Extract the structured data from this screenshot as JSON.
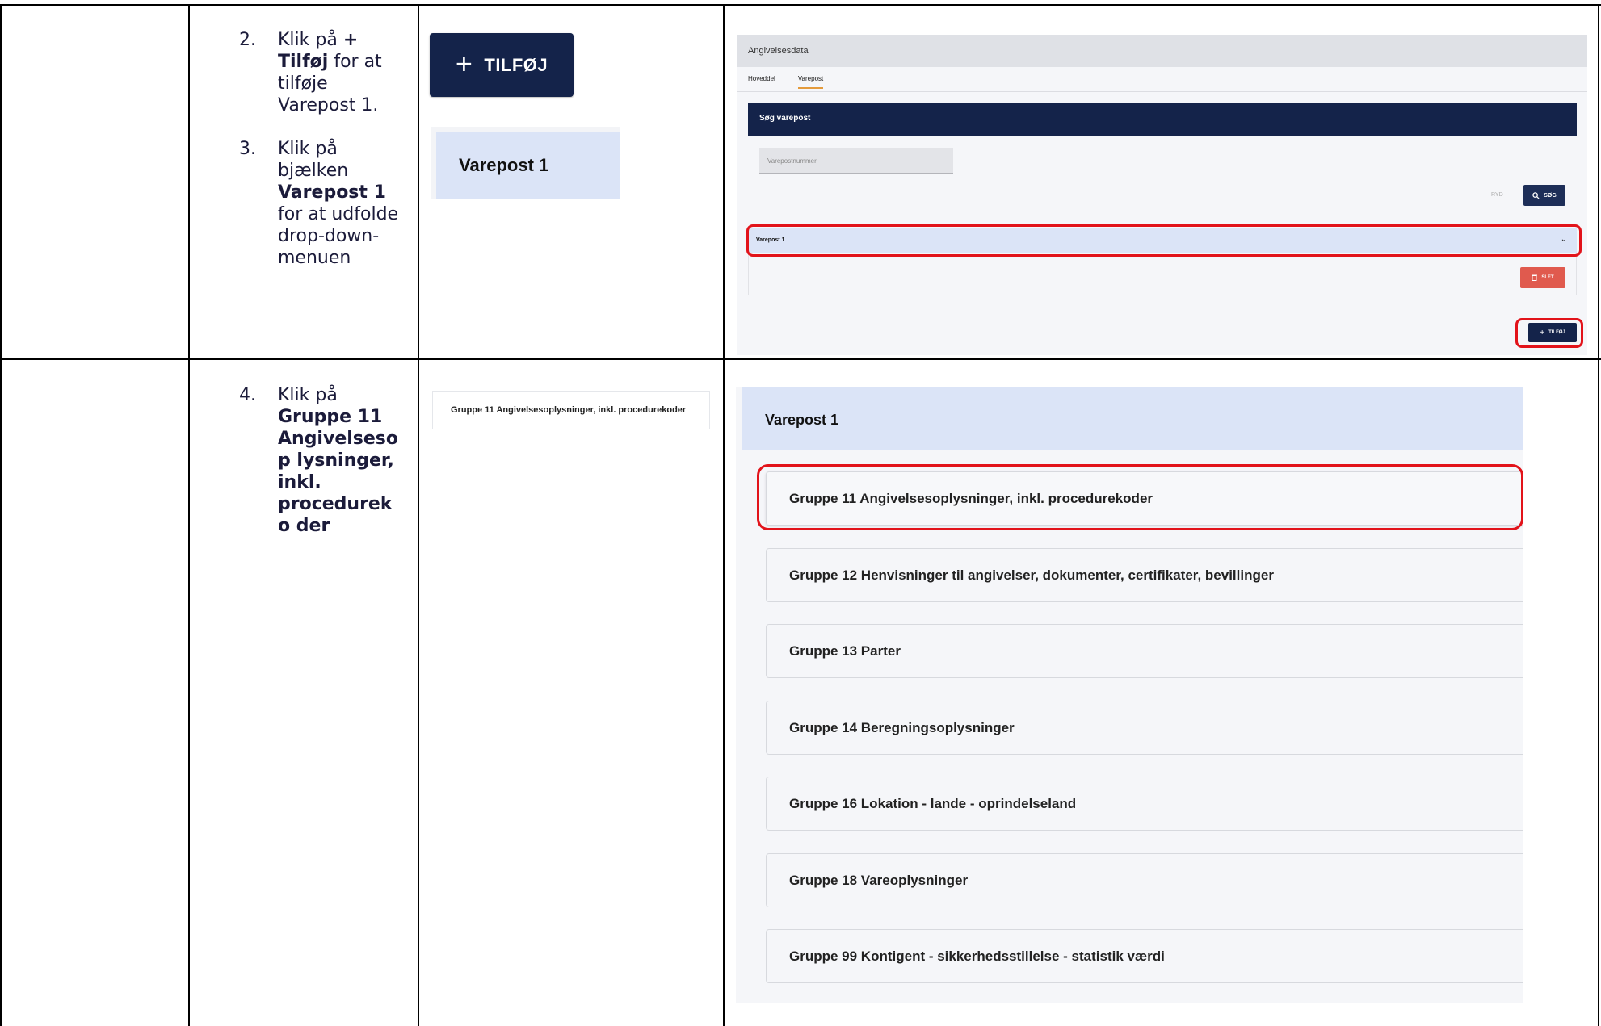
{
  "steps": [
    {
      "num": "2.",
      "pre": "Klik på ",
      "bold": "+ Tilføj",
      "post": " for at tilføje Varepost 1."
    },
    {
      "num": "3.",
      "pre": "Klik på bjælken ",
      "bold": "Varepost 1",
      "post": " for at udfolde drop-down-menuen"
    },
    {
      "num": "4.",
      "pre": "Klik på ",
      "bold": "Gruppe 11 Angivelsesop lysninger, inkl. procedureko der",
      "post": ""
    }
  ],
  "snippets": {
    "tilfoj_label": "TILFØJ",
    "plus_symbol": "+",
    "varepost_label": "Varepost 1",
    "gruppe_label": "Gruppe 11 Angivelsesoplysninger, inkl. procedurekoder"
  },
  "panel1": {
    "header": "Angivelsesdata",
    "tabs": [
      "Hoveddel",
      "Varepost"
    ],
    "search_title": "Søg varepost",
    "input_placeholder": "Varepostnummer",
    "ryd_label": "RYD",
    "sog_label": "SØG",
    "varepost_label": "Varepost 1",
    "chevron": "⌄",
    "slet_label": "SLET",
    "tilfoj_label": "TILFØJ"
  },
  "panel2": {
    "header": "Varepost 1",
    "groups": [
      "Gruppe 11 Angivelsesoplysninger, inkl. procedurekoder",
      "Gruppe 12 Henvisninger til angivelser, dokumenter, certifikater, bevillinger",
      "Gruppe 13 Parter",
      "Gruppe 14 Beregningsoplysninger",
      "Gruppe 16 Lokation - lande - oprindelseland",
      "Gruppe 18 Vareoplysninger",
      "Gruppe 99 Kontigent - sikkerhedsstillelse - statistik værdi"
    ]
  },
  "colors": {
    "navy": "#14234a",
    "highlight_red": "#e2131a",
    "varepost_blue": "#dbe4f7",
    "slet_red": "#e05a4e"
  }
}
